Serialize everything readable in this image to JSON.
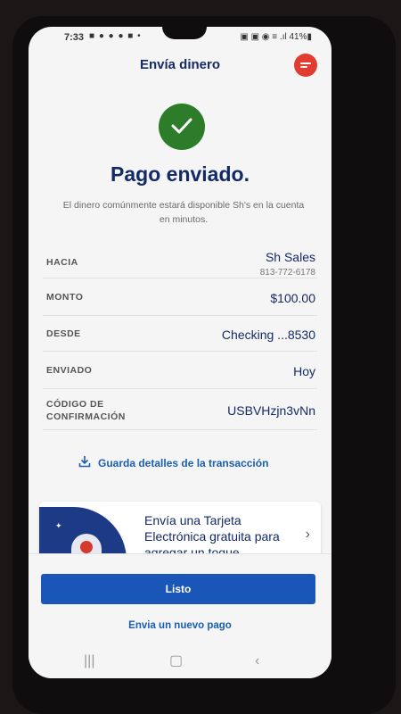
{
  "status": {
    "time": "7:33",
    "left_icons": "■ ● ● ● ■ •",
    "right_icons": "▣ ▣ ◉ ≡ .ıl 41%▮"
  },
  "header": {
    "title": "Envía dinero"
  },
  "confirmation": {
    "title": "Pago enviado.",
    "subtitle": "El dinero comúnmente estará disponible Sh's en la cuenta en minutos."
  },
  "details": [
    {
      "label": "HACIA",
      "value": "Sh Sales",
      "sub": "813-772-6178"
    },
    {
      "label": "MONTO",
      "value": "$100.00"
    },
    {
      "label": "DESDE",
      "value": "Checking ...8530"
    },
    {
      "label": "ENVIADO",
      "value": "Hoy"
    },
    {
      "label": "CÓDIGO DE",
      "label2": "CONFIRMACIÓN",
      "value": "USBVHzjn3vNn"
    }
  ],
  "save_details": "Guarda detalles de la transacción",
  "promo": {
    "text": "Envía una Tarjeta Electrónica gratuita para agregar un toque"
  },
  "actions": {
    "done": "Listo",
    "new_payment": "Envia un nuevo pago"
  },
  "colors": {
    "brand_navy": "#142a66",
    "primary_blue": "#1a56b8",
    "success_green": "#2c7c2a",
    "chat_red": "#e23b2f"
  }
}
